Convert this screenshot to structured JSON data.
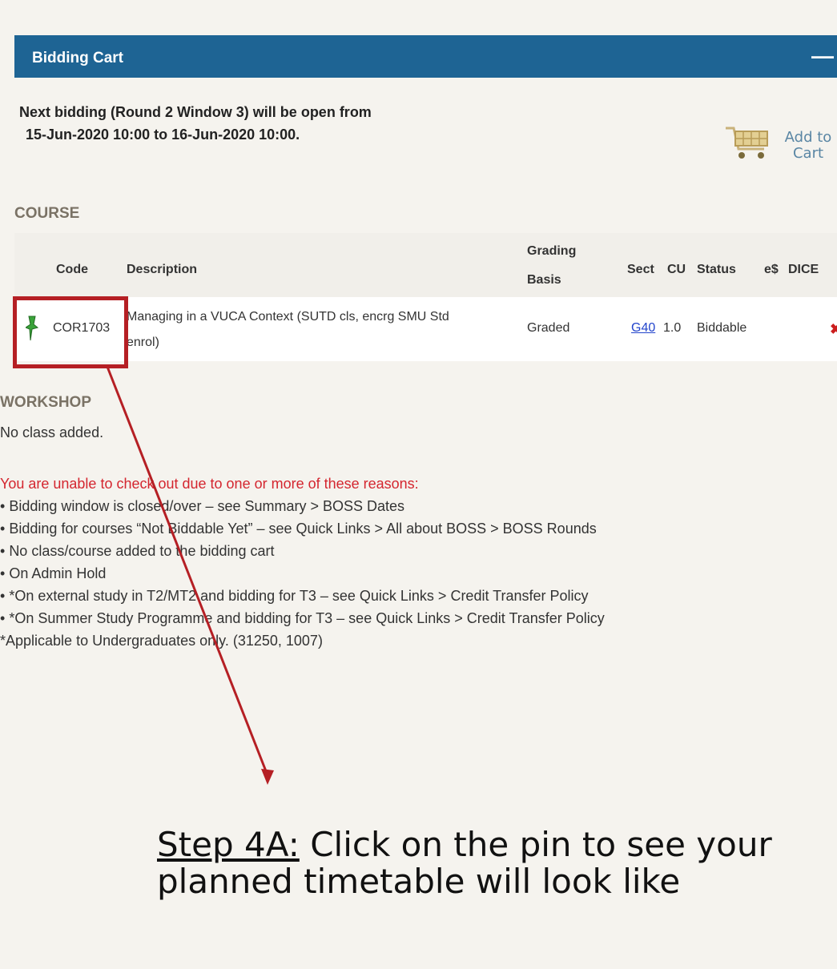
{
  "panel": {
    "title": "Bidding Cart",
    "collapse_symbol": "—"
  },
  "notice": {
    "line1": "Next bidding (Round 2 Window 3) will be open from",
    "line2": "15-Jun-2020 10:00 to 16-Jun-2020 10:00."
  },
  "add_to_cart": {
    "label_line1": "Add to",
    "label_line2": "Cart",
    "icon": "shopping-cart-icon"
  },
  "course": {
    "section_label": "COURSE",
    "headers": {
      "code": "Code",
      "description": "Description",
      "grading_line1": "Grading",
      "grading_line2": "Basis",
      "sect": "Sect",
      "cu": "CU",
      "status": "Status",
      "edollar": "e$",
      "dice": "DICE"
    },
    "rows": [
      {
        "code": "COR1703",
        "description_line1": "Managing in a VUCA Context (SUTD cls, encrg SMU Std",
        "description_line2": "enrol)",
        "grading": "Graded",
        "sect": "G40",
        "cu": "1.0",
        "status": "Biddable",
        "delete_symbol": "✖"
      }
    ]
  },
  "workshop": {
    "section_label": "WORKSHOP",
    "empty_text": "No class added."
  },
  "checkout": {
    "warning": "You are unable to check out due to one or more of these reasons:",
    "reasons": [
      "Bidding window is closed/over – see Summary > BOSS Dates",
      "Bidding for courses “Not Biddable Yet” – see Quick Links > All about BOSS > BOSS Rounds",
      "No class/course added to the bidding cart",
      "On Admin Hold",
      "*On external study in T2/MT2 and bidding for T3 – see Quick Links > Credit Transfer Policy",
      "*On Summer Study Programme and bidding for T3 – see Quick Links > Credit Transfer Policy"
    ],
    "footnote": "*Applicable to Undergraduates only. (31250, 1007)"
  },
  "annotation": {
    "step_label": "Step 4A:",
    "step_text": " Click on the pin to see your planned timetable will look like",
    "color": "#b51f24"
  },
  "colors": {
    "header_bg": "#1e6494",
    "warning_text": "#d4262f",
    "link": "#2244cc",
    "pin": "#3aa33a"
  }
}
